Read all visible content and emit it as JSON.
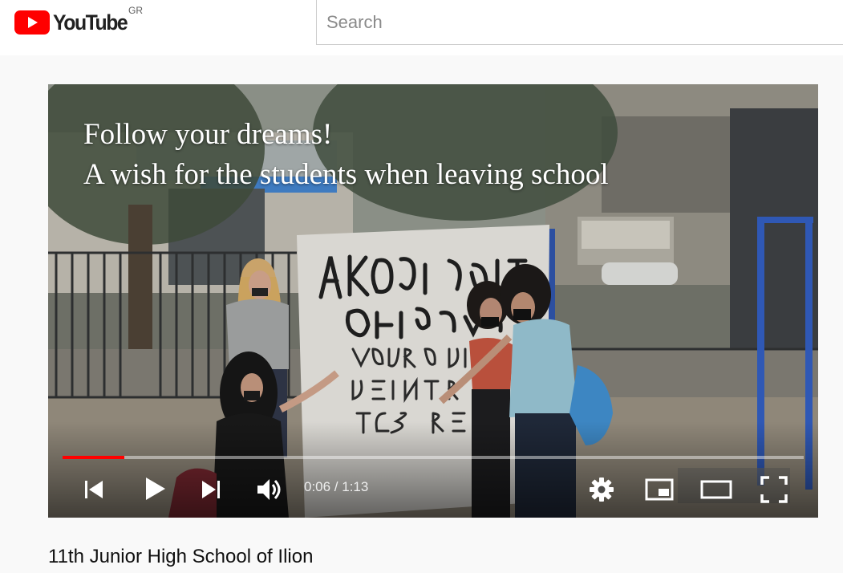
{
  "header": {
    "logo_text": "YouTube",
    "region": "GR",
    "search_placeholder": "Search"
  },
  "video": {
    "overlay_line1": "Follow your dreams!",
    "overlay_line2": "A wish for the students when leaving school",
    "time_display": "0:06 / 1:13",
    "progress_fraction": 0.083,
    "title": "11th Junior High School of Ilion"
  },
  "controls": {
    "icons": [
      "previous-icon",
      "play-icon",
      "next-icon",
      "volume-icon",
      "settings-icon",
      "miniplayer-icon",
      "theater-mode-icon",
      "fullscreen-icon"
    ]
  },
  "colors": {
    "brand_red": "#ff0000",
    "progress_red": "#ff0000",
    "header_bg": "#ffffff",
    "page_bg": "#f9f9f9"
  }
}
